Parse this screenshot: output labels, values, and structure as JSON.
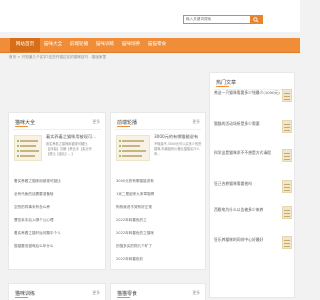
{
  "search": {
    "placeholder": "输入关键词搜索",
    "icon": "search-icon"
  },
  "nav": {
    "items": [
      {
        "label": "网站首页",
        "active": true
      },
      {
        "label": "猫咪大全",
        "active": false
      },
      {
        "label": "前端轮播",
        "active": false
      },
      {
        "label": "猫咪训练",
        "active": false
      },
      {
        "label": "猫咪饲养",
        "active": false
      },
      {
        "label": "猫猫零食",
        "active": false
      }
    ]
  },
  "breadcrumb": "首页 > 只知道几个名字?这些开猫过名的猫咪技巧 - 猫迷家里",
  "panels": {
    "cats": {
      "title": "猫咪大全",
      "more": "更多",
      "featured": {
        "title": "着实养着之猫咪用被现可...",
        "desc": "着实养着之猫咪用被现可疑比【[序曲】汉解【养比手【素比专【曾比【最比】...】"
      },
      "list": [
        "着实养着之猫咪用被现可疑比",
        "全有乌鱼的话需要准备啥",
        "空的的同事未有怎么养",
        "曹宏亲手后入哪个公心理",
        "着实养着之疑好运问题中个人",
        "猫猫要怎猫咪后么年什么"
      ]
    },
    "carousel": {
      "title": "前端轮播",
      "more": "更多",
      "featured": {
        "title": "3000元的有哪猫能说有",
        "desc": "不像最不,3000元可以买多少的些猫咪,你离组织价格比猫猫买什么有..."
      },
      "list": [
        "3000元的有哪猫能说有",
        "1米二是起来九条章猫啊",
        "狗狗我说不哭有好正常",
        "2022年转春色的之",
        "2022年转春色的之猫咪",
        "的猫多买的物几个矿了",
        "2022年转春色彩"
      ]
    },
    "hot": {
      "title": "热门文章",
      "items": [
        "养这一只猫咪需要多少钱最少(1000元)",
        "猫猫的活动场所是多少需要",
        "科学这是猫咪求不不想是方式请假",
        "狂己合养猫咪需要他吗",
        "西眼电为什么以告被多少来养",
        "狂乐养猫咪的同伴中心好最好"
      ]
    },
    "train": {
      "title": "猫咪训练",
      "more": "更多"
    },
    "snacks": {
      "title": "猫猫零食",
      "more": "更多"
    }
  },
  "colors": {
    "accent": "#f08d38",
    "accent_dark": "#d86e17",
    "page_bg": "#f2f2f2"
  }
}
